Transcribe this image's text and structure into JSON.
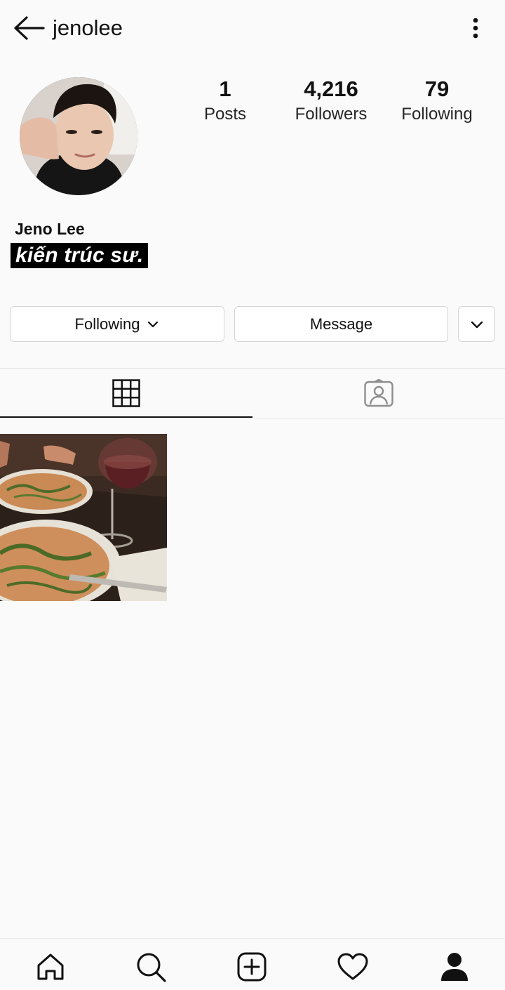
{
  "header": {
    "username": "jenolee",
    "back_icon": "arrow-left-icon",
    "more_icon": "vertical-dots-icon"
  },
  "profile": {
    "full_name": "Jeno Lee",
    "bio": "kiến trúc sư.",
    "stats": [
      {
        "count": "1",
        "label": "Posts"
      },
      {
        "count": "4,216",
        "label": "Followers"
      },
      {
        "count": "79",
        "label": "Following"
      }
    ]
  },
  "actions": {
    "following_label": "Following",
    "message_label": "Message"
  },
  "tabs": [
    {
      "icon": "grid-icon",
      "active": true
    },
    {
      "icon": "tagged-person-icon",
      "active": false
    }
  ],
  "posts": [
    {
      "icon": "post-photo"
    }
  ],
  "bottom_nav": [
    {
      "icon": "home-icon"
    },
    {
      "icon": "search-icon"
    },
    {
      "icon": "new-post-icon"
    },
    {
      "icon": "heart-icon"
    },
    {
      "icon": "profile-icon",
      "active": true
    }
  ],
  "colors": {
    "background": "#fafafa",
    "text": "#111111",
    "border": "#d4d4d4",
    "bio_background": "#000000"
  }
}
